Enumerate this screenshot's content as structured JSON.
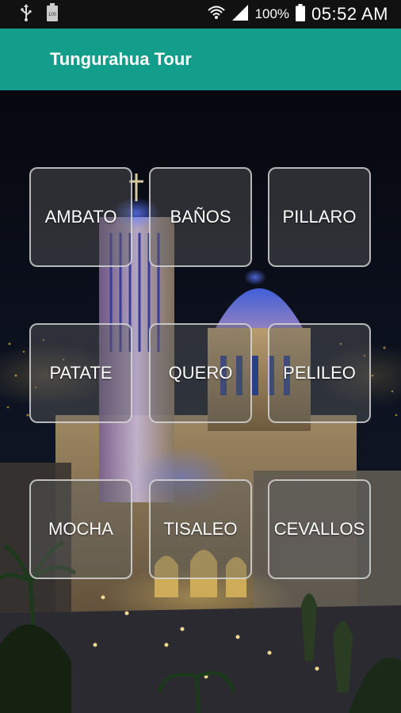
{
  "status_bar": {
    "battery_small": "100",
    "battery_percent": "100%",
    "time": "05:52 AM"
  },
  "app_bar": {
    "title": "Tungurahua Tour"
  },
  "tiles": [
    {
      "label": "AMBATO"
    },
    {
      "label": "BAÑOS"
    },
    {
      "label": "PILLARO"
    },
    {
      "label": "PATATE"
    },
    {
      "label": "QUERO"
    },
    {
      "label": "PELILEO"
    },
    {
      "label": "MOCHA"
    },
    {
      "label": "TISALEO"
    },
    {
      "label": "CEVALLOS"
    }
  ],
  "colors": {
    "app_bar": "#129e8a",
    "status_bar": "#111111"
  }
}
